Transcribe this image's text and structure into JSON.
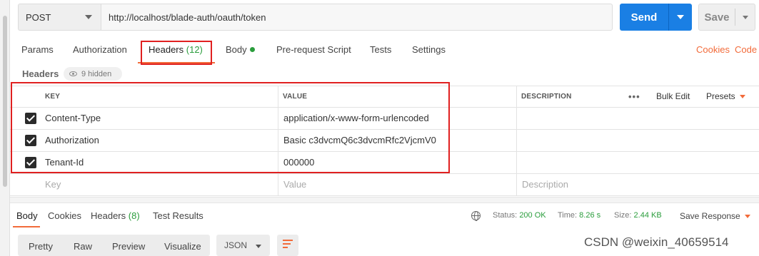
{
  "request": {
    "method": "POST",
    "url": "http://localhost/blade-auth/oauth/token",
    "send_label": "Send",
    "save_label": "Save"
  },
  "request_tabs": [
    {
      "label": "Params"
    },
    {
      "label": "Authorization"
    },
    {
      "label": "Headers",
      "count": "(12)",
      "active": true
    },
    {
      "label": "Body",
      "has_dot": true
    },
    {
      "label": "Pre-request Script"
    },
    {
      "label": "Tests"
    },
    {
      "label": "Settings"
    }
  ],
  "right_links": {
    "cookies": "Cookies",
    "code": "Code"
  },
  "headers_section": {
    "title": "Headers",
    "hidden_label": "9 hidden"
  },
  "table": {
    "columns": {
      "key": "KEY",
      "value": "VALUE",
      "description": "DESCRIPTION"
    },
    "actions": {
      "bulk_edit": "Bulk Edit",
      "presets": "Presets"
    },
    "rows": [
      {
        "checked": true,
        "key": "Content-Type",
        "value": "application/x-www-form-urlencoded",
        "description": ""
      },
      {
        "checked": true,
        "key": "Authorization",
        "value": "Basic c3dvcmQ6c3dvcmRfc2VjcmV0",
        "description": ""
      },
      {
        "checked": true,
        "key": "Tenant-Id",
        "value": "000000",
        "description": ""
      }
    ],
    "placeholders": {
      "key": "Key",
      "value": "Value",
      "description": "Description"
    }
  },
  "response": {
    "tabs": [
      {
        "label": "Body",
        "active": true
      },
      {
        "label": "Cookies"
      },
      {
        "label": "Headers",
        "count": "(8)"
      },
      {
        "label": "Test Results"
      }
    ],
    "status_label": "Status:",
    "status_value": "200 OK",
    "time_label": "Time:",
    "time_value": "8.26 s",
    "size_label": "Size:",
    "size_value": "2.44 KB",
    "save_response": "Save Response",
    "view_modes": [
      "Pretty",
      "Raw",
      "Preview",
      "Visualize"
    ],
    "format": "JSON"
  },
  "watermark": "CSDN @weixin_40659514",
  "colors": {
    "accent": "#f26b3a",
    "send": "#1a7fe4",
    "highlight": "#e02020",
    "green": "#2a9d3c"
  }
}
